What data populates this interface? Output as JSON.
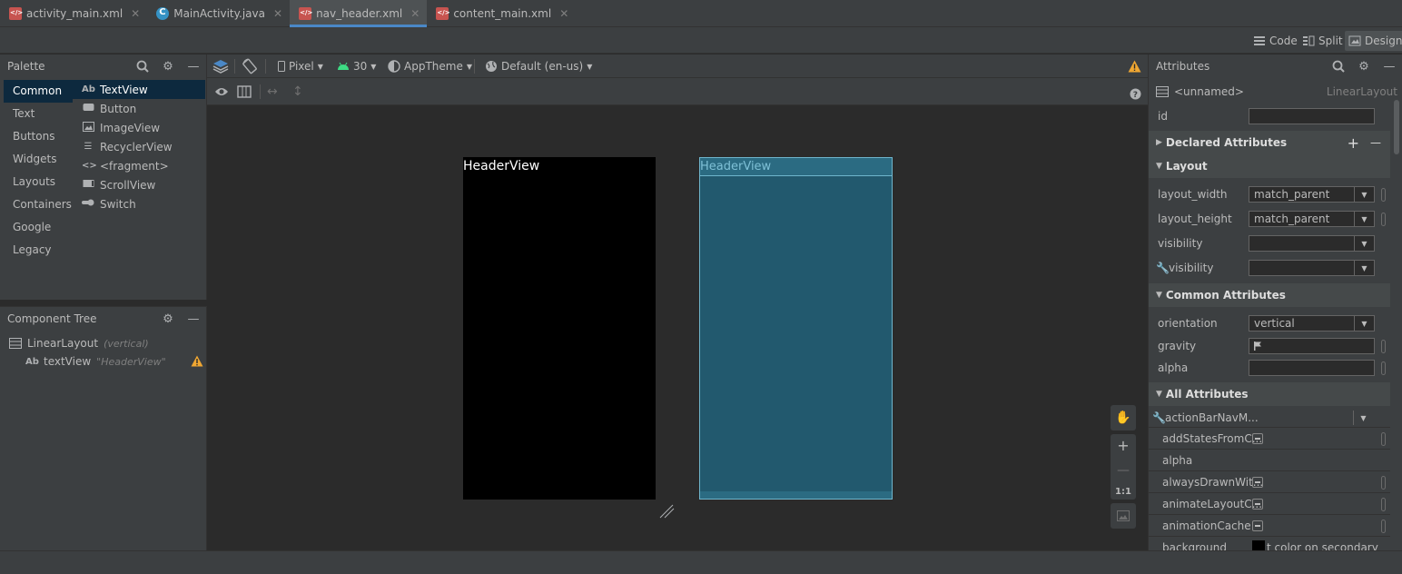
{
  "tabs": [
    {
      "label": "activity_main.xml",
      "icon": "xml-file-icon",
      "active": false
    },
    {
      "label": "MainActivity.java",
      "icon": "java-class-icon",
      "active": false
    },
    {
      "label": "nav_header.xml",
      "icon": "xml-file-icon",
      "active": true
    },
    {
      "label": "content_main.xml",
      "icon": "xml-file-icon",
      "active": false
    }
  ],
  "view_modes": {
    "code": "Code",
    "split": "Split",
    "design": "Design",
    "active": "Design"
  },
  "palette": {
    "title": "Palette",
    "categories": [
      "Common",
      "Text",
      "Buttons",
      "Widgets",
      "Layouts",
      "Containers",
      "Google",
      "Legacy"
    ],
    "selected_category": "Common",
    "widgets": [
      {
        "icon": "Ab",
        "label": "TextView"
      },
      {
        "icon": "btn",
        "label": "Button"
      },
      {
        "icon": "img",
        "label": "ImageView"
      },
      {
        "icon": "list",
        "label": "RecyclerView"
      },
      {
        "icon": "<>",
        "label": "<fragment>"
      },
      {
        "icon": "scroll",
        "label": "ScrollView"
      },
      {
        "icon": "switch",
        "label": "Switch"
      }
    ]
  },
  "component_tree": {
    "title": "Component Tree",
    "root": {
      "label": "LinearLayout",
      "detail": "(vertical)"
    },
    "child": {
      "icon": "Ab",
      "label": "textView",
      "detail": "\"HeaderView\"",
      "warning": true
    }
  },
  "design_toolbar": {
    "device": "Pixel",
    "api": "30",
    "theme": "AppTheme",
    "locale": "Default (en-us)"
  },
  "canvas": {
    "design_text": "HeaderView",
    "blueprint_text": "HeaderView",
    "zoom_label": "1:1"
  },
  "attributes": {
    "title": "Attributes",
    "component_name": "<unnamed>",
    "component_type": "LinearLayout",
    "id_label": "id",
    "id_value": "",
    "declared_section": "Declared Attributes",
    "layout_section": "Layout",
    "layout_width_label": "layout_width",
    "layout_width_value": "match_parent",
    "layout_height_label": "layout_height",
    "layout_height_value": "match_parent",
    "visibility_label": "visibility",
    "visibility_value": "",
    "tools_visibility_label": "visibility",
    "tools_visibility_value": "",
    "common_section": "Common Attributes",
    "orientation_label": "orientation",
    "orientation_value": "vertical",
    "gravity_label": "gravity",
    "alpha_label": "alpha",
    "alpha_value": "",
    "all_section": "All Attributes",
    "all_rows": [
      {
        "label": "actionBarNavM...",
        "kind": "dropdown"
      },
      {
        "label": "addStatesFromC...",
        "kind": "checkbox"
      },
      {
        "label": "alpha",
        "kind": "empty"
      },
      {
        "label": "alwaysDrawnWit...",
        "kind": "checkbox"
      },
      {
        "label": "animateLayoutC...",
        "kind": "checkbox"
      },
      {
        "label": "animationCache",
        "kind": "checkbox"
      },
      {
        "label": "background",
        "kind": "color",
        "value": "t color on secondary"
      }
    ]
  },
  "colors": {
    "accent": "#4a88c7",
    "warning": "#f0a732",
    "blueprint": "#22596e",
    "selection": "#0d293e"
  }
}
